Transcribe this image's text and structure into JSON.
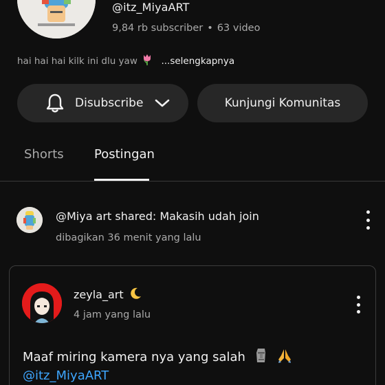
{
  "channel": {
    "handle": "@itz_MiyaART",
    "subscribers": "9,84 rb subscriber",
    "separator": "•",
    "videos": "63 video",
    "description": "hai hai hai kilk ini dlu yaw",
    "description_emoji": "tulip-icon",
    "more_label": "...selengkapnya"
  },
  "actions": {
    "subscribe_label": "Disubscribe",
    "community_label": "Kunjungi Komunitas"
  },
  "tabs": [
    {
      "label": "Shorts",
      "selected": false
    },
    {
      "label": "Postingan",
      "selected": true
    }
  ],
  "post": {
    "title": "@Miya art shared: Makasih udah join",
    "time": "dibagikan 36 menit yang lalu",
    "embedded": {
      "author": "zeyla_art",
      "author_emoji": "crescent-moon-icon",
      "time": "4 jam yang lalu",
      "text": "Maaf miring kamera nya yang salah",
      "text_emojis": [
        "moai-icon",
        "folded-hands-icon"
      ],
      "mention": "@itz_MiyaART"
    }
  },
  "colors": {
    "background": "#0f0f0f",
    "button": "#272727",
    "secondary_text": "#aaaaaa",
    "link": "#3ea6ff",
    "avatar_red": "#e41b1b"
  }
}
